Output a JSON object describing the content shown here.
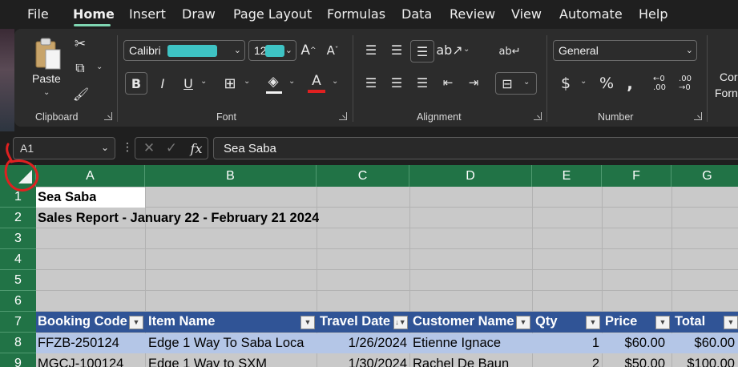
{
  "menu": {
    "tabs": [
      "File",
      "Home",
      "Insert",
      "Draw",
      "Page Layout",
      "Formulas",
      "Data",
      "Review",
      "View",
      "Automate",
      "Help"
    ],
    "active": "Home"
  },
  "ribbon": {
    "clipboard": {
      "label": "Clipboard",
      "paste_label": "Paste"
    },
    "font": {
      "label": "Font",
      "font_name": "Calibri",
      "font_size": "12"
    },
    "alignment": {
      "label": "Alignment"
    },
    "number": {
      "label": "Number",
      "format": "General"
    },
    "cut_labels": [
      "Cor",
      "Forn"
    ]
  },
  "formula_bar": {
    "name_box": "A1",
    "formula": "Sea Saba",
    "fx": "fx"
  },
  "sheet": {
    "columns": [
      "A",
      "B",
      "C",
      "D",
      "E",
      "F",
      "G"
    ],
    "rows": [
      "1",
      "2",
      "3",
      "4",
      "5",
      "6",
      "7",
      "8",
      "9"
    ],
    "a1": "Sea Saba",
    "a2": "Sales Report - January 22 - February 21 2024",
    "table_headers": [
      "Booking Code",
      "Item Name",
      "Travel Date",
      "Customer Name",
      "Qty",
      "Price",
      "Total"
    ],
    "row8": [
      "FFZB-250124",
      "Edge 1 Way To Saba Loca",
      "1/26/2024",
      "Etienne Ignace",
      "1",
      "$60.00",
      "$60.00"
    ],
    "row9": [
      "MGCJ-100124",
      "Edge 1 Way to SXM",
      "1/30/2024",
      "Rachel De Baun",
      "2",
      "$50.00",
      "$100.00"
    ]
  },
  "colors": {
    "accent_green": "#217346",
    "table_header_blue": "#305496",
    "band_blue": "#b4c6e7",
    "annotation_red": "#e02020"
  }
}
